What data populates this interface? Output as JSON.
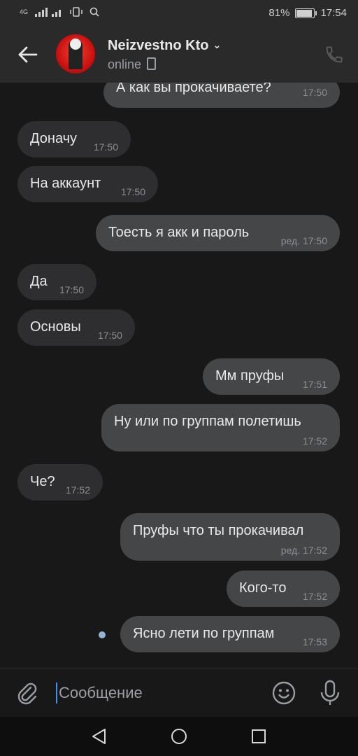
{
  "statusbar": {
    "network_label": "4G",
    "battery": "81%",
    "battery_level": 0.81,
    "time": "17:54"
  },
  "header": {
    "contact_name": "Neizvestno Kto",
    "status": "online"
  },
  "messages": [
    {
      "dir": "out",
      "text": "А как вы прокачиваете?",
      "time": "17:50"
    },
    {
      "dir": "in",
      "text": "Доначу",
      "time": "17:50"
    },
    {
      "dir": "in",
      "text": "На аккаунт",
      "time": "17:50"
    },
    {
      "dir": "out",
      "text": "Тоесть я акк и пароль",
      "time": "ред. 17:50"
    },
    {
      "dir": "in",
      "text": "Да",
      "time": "17:50"
    },
    {
      "dir": "in",
      "text": "Основы",
      "time": "17:50"
    },
    {
      "dir": "out",
      "text": "Мм пруфы",
      "time": "17:51"
    },
    {
      "dir": "out",
      "text": "Ну или по группам полетишь",
      "time": "17:52"
    },
    {
      "dir": "in",
      "text": "Че?",
      "time": "17:52"
    },
    {
      "dir": "out",
      "text": "Пруфы что ты прокачивал",
      "time": "ред. 17:52"
    },
    {
      "dir": "out",
      "text": "Кого-то",
      "time": "17:52"
    },
    {
      "dir": "out",
      "text": "Ясно лети по группам",
      "time": "17:53"
    }
  ],
  "composer": {
    "placeholder": "Сообщение"
  },
  "colors": {
    "background": "#181818",
    "header": "#2a2a2b",
    "incoming_bubble": "#2e2e30",
    "outgoing_bubble": "#454648",
    "accent": "#4a8ee0"
  }
}
